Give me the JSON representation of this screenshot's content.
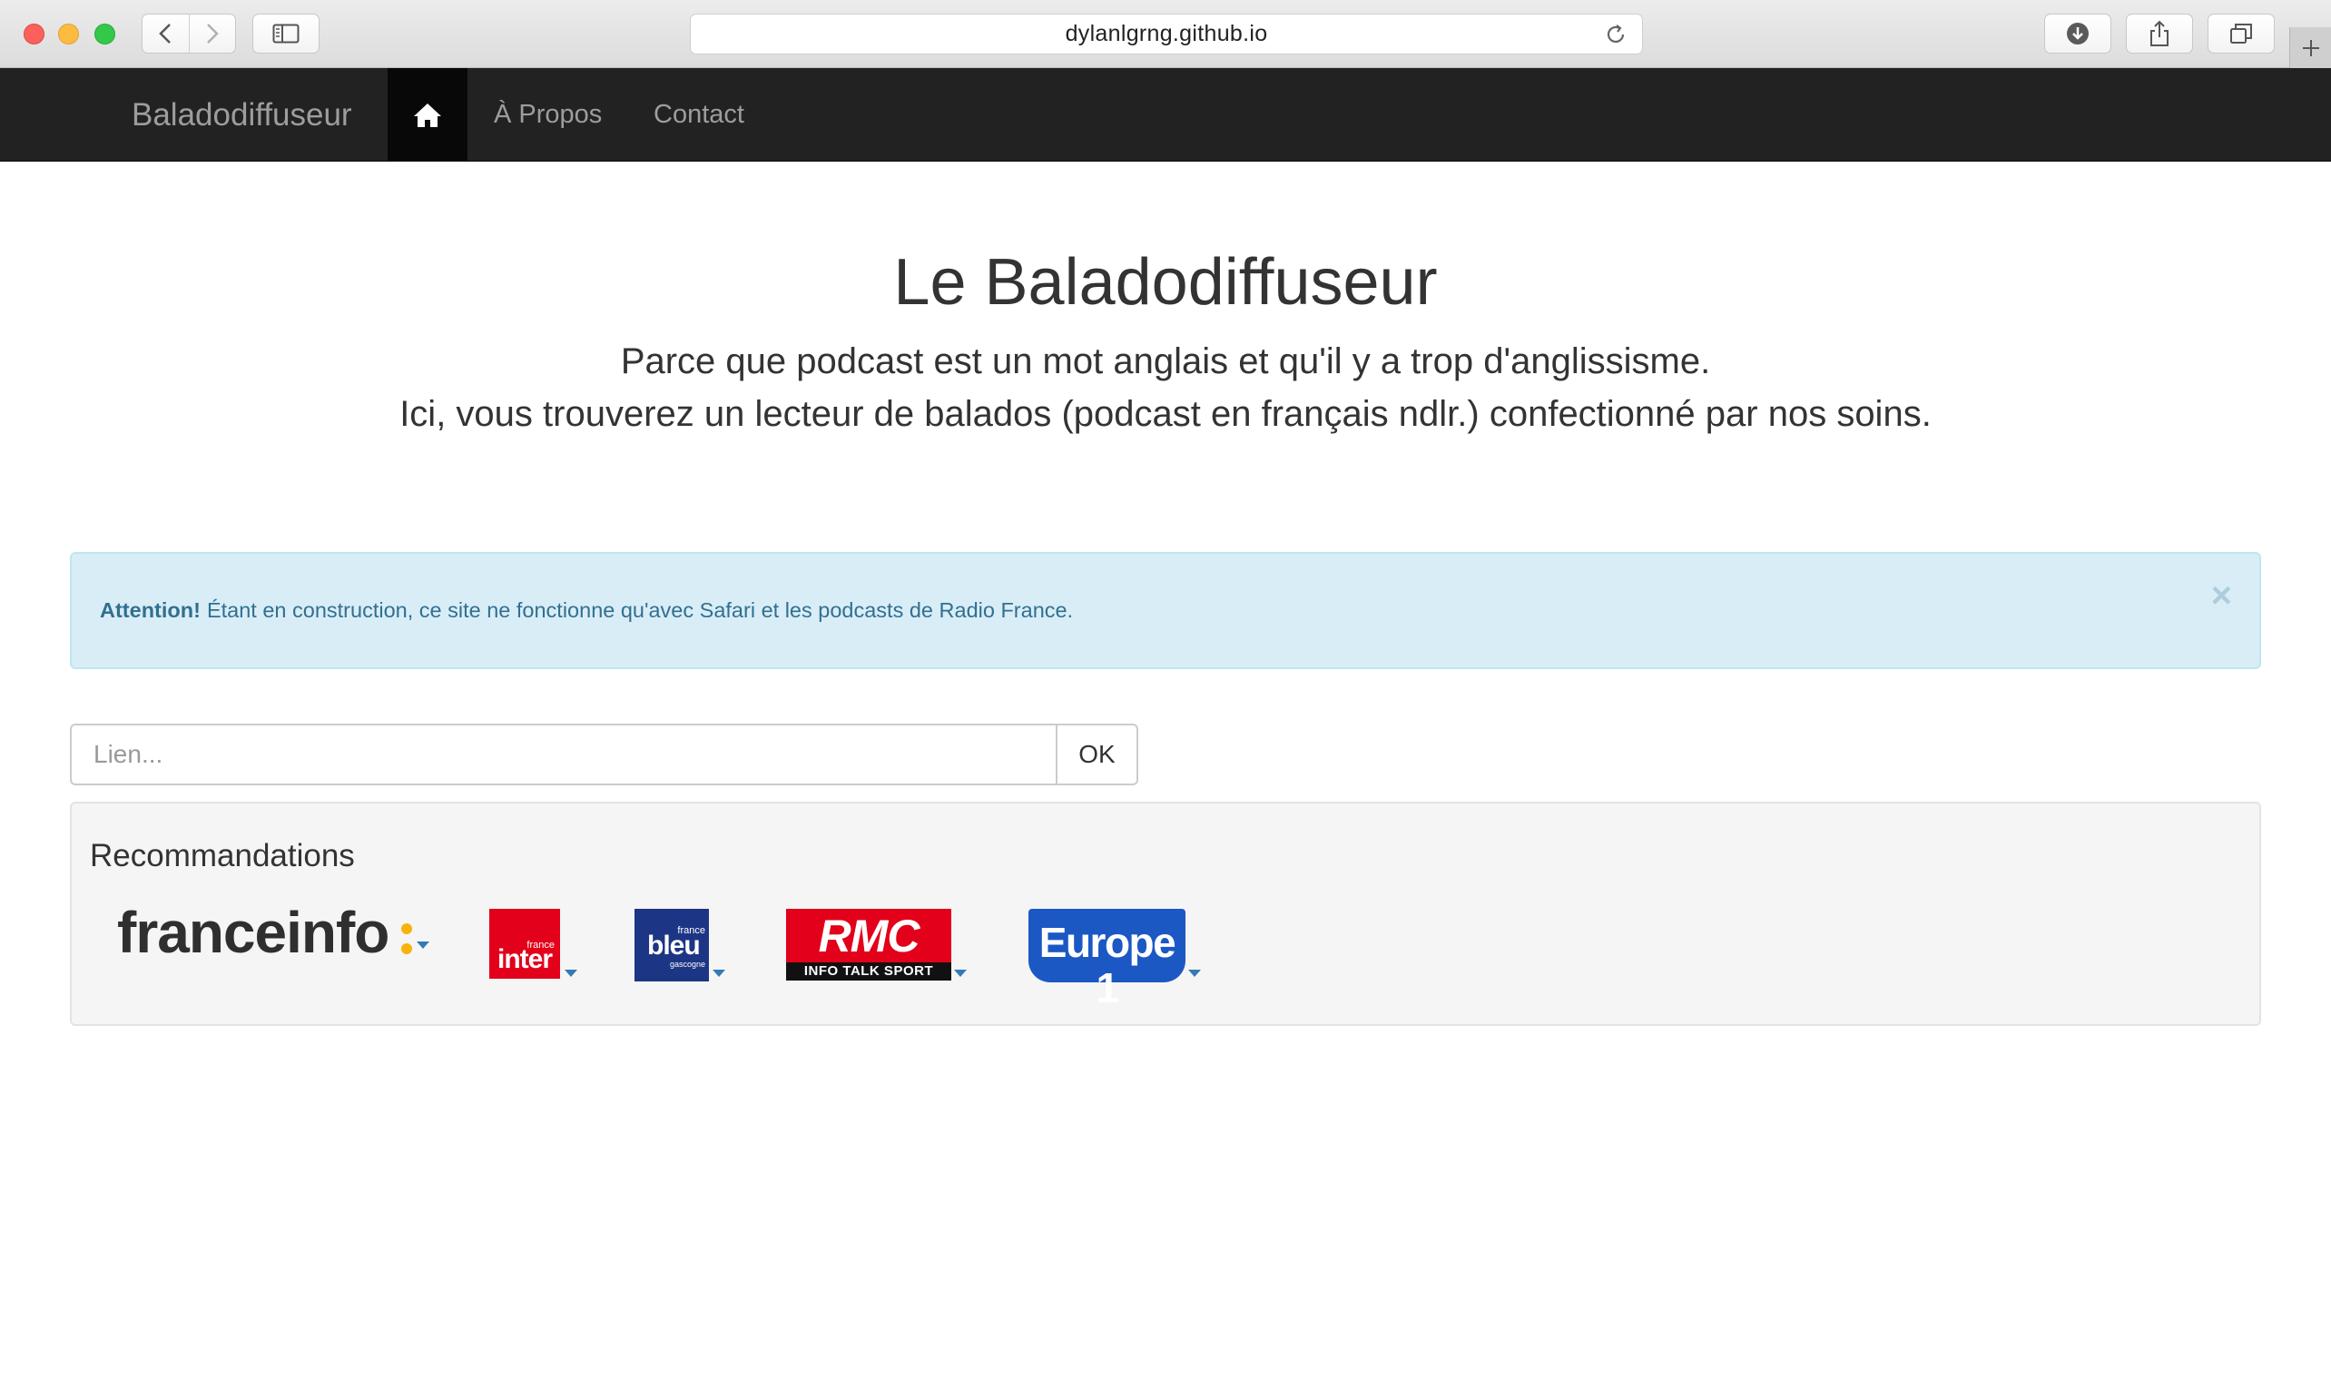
{
  "browser": {
    "url": "dylanlgrng.github.io"
  },
  "navbar": {
    "brand": "Baladodiffuseur",
    "home_icon": "home-icon",
    "links": [
      "À Propos",
      "Contact"
    ]
  },
  "hero": {
    "title": "Le Baladodiffuseur",
    "subtitle_line1": "Parce que podcast est un mot anglais et qu'il y a trop d'anglissisme.",
    "subtitle_line2": "Ici, vous trouverez un lecteur de balados (podcast en français ndlr.) confectionné par nos soins."
  },
  "alert": {
    "strong": "Attention!",
    "text": "Étant en construction, ce site ne fonctionne qu'avec Safari et les podcasts de Radio France.",
    "close": "×"
  },
  "search": {
    "placeholder": "Lien...",
    "value": "",
    "button": "OK"
  },
  "recommendations": {
    "title": "Recommandations",
    "stations": [
      {
        "name": "franceinfo",
        "logo_text": "franceinfo"
      },
      {
        "name": "France Inter",
        "logo_top": "france",
        "logo_text": "inter"
      },
      {
        "name": "France Bleu",
        "logo_top": "france",
        "logo_text": "bleu",
        "logo_sub": "gascogne"
      },
      {
        "name": "RMC",
        "logo_text": "RMC",
        "logo_sub": "INFO TALK SPORT"
      },
      {
        "name": "Europe 1",
        "logo_text": "Europe 1"
      }
    ]
  },
  "colors": {
    "navbar_bg": "#222222",
    "navbar_active": "#080808",
    "alert_bg": "#d9edf7",
    "alert_text": "#31708f",
    "caret": "#337ab7"
  }
}
